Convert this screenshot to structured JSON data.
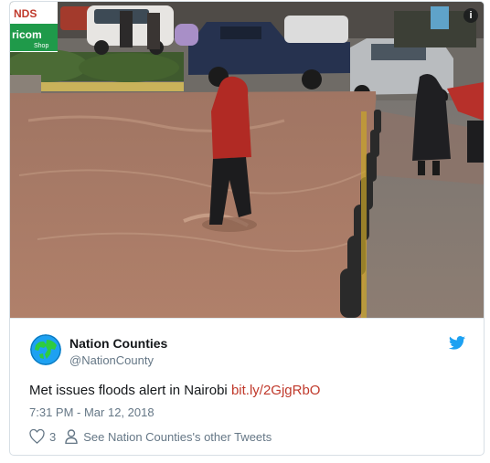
{
  "photo": {
    "alt_icon": "info-icon",
    "banner_top": "NDS",
    "banner_bottom": "ricom",
    "banner_small": "Shop"
  },
  "tweet": {
    "display_name": "Nation Counties",
    "handle": "@NationCounty",
    "text": "Met issues floods alert in Nairobi",
    "link_text": "bit.ly/2GjgRbO",
    "timestamp": "7:31 PM - Mar 12, 2018",
    "like_count": "3",
    "other_tweets_label": "See Nation Counties's other Tweets"
  },
  "icons": {
    "info": "info-icon",
    "avatar": "globe-avatar",
    "brand": "twitter-bird-icon",
    "like": "heart-icon",
    "profile": "person-icon"
  },
  "colors": {
    "link": "#c0392b",
    "brand_blue": "#1da1f2",
    "muted": "#657786",
    "text": "#14171a"
  }
}
